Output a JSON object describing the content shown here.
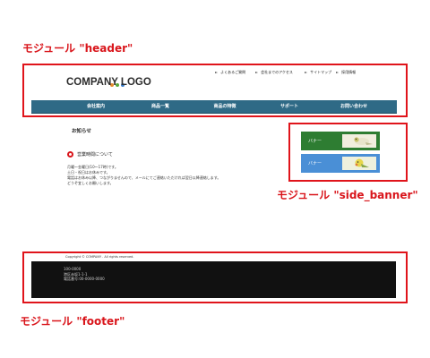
{
  "labels": {
    "header": "モジュール \"header\"",
    "side_banner": "モジュール \"side_banner\"",
    "footer": "モジュール \"footer\""
  },
  "header": {
    "logo": "COMPANY LOGO",
    "logo_dot_colors": [
      "#e58a2c",
      "#5aa63a",
      "#3a7dc9"
    ],
    "top_nav": [
      "よくあるご質問",
      "会社までのアクセス",
      "サイトマップ",
      "採用情報"
    ],
    "main_nav": [
      "会社案内",
      "商品一覧",
      "商品の特徴",
      "サポート",
      "お問い合わせ"
    ],
    "nav_color": "#2f6a86"
  },
  "content": {
    "section_title": "お知らせ",
    "news_title": "営業時間について",
    "news_lines": [
      "月曜～金曜日(10～17時)です。",
      "土日・祝日はお休みです。",
      "電話はお休み以降、つながりませんので、メールにてご連絡いただければ翌日以降連絡します。",
      "どうぞ宜しくお願いします。"
    ]
  },
  "side_banner": {
    "items": [
      {
        "label": "バナー",
        "color": "#2e7d32"
      },
      {
        "label": "バナー",
        "color": "#4a8fd6"
      }
    ]
  },
  "footer": {
    "copyright": "Copyright © COMPANY . All rights reserved.",
    "address_lines": [
      "100-0000",
      "港区赤坂1-1-1",
      "電話番号:00-0000-0000"
    ]
  },
  "accent_color": "#e0141b"
}
